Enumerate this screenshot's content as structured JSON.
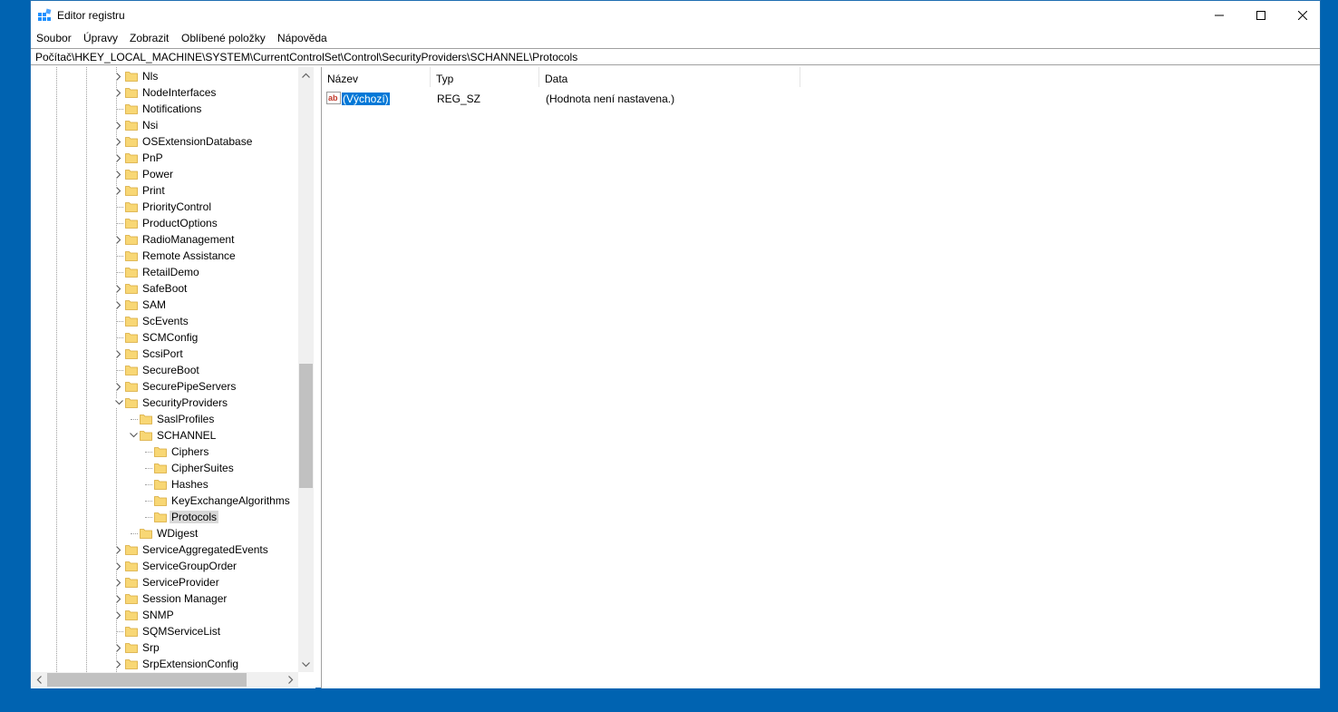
{
  "window": {
    "title": "Editor registru",
    "minimize_glyph": "—",
    "maximize_glyph": "☐",
    "close_glyph": "✕"
  },
  "menu": [
    "Soubor",
    "Úpravy",
    "Zobrazit",
    "Oblíbené položky",
    "Nápověda"
  ],
  "address": "Počítač\\HKEY_LOCAL_MACHINE\\SYSTEM\\CurrentControlSet\\Control\\SecurityProviders\\SCHANNEL\\Protocols",
  "tree": [
    {
      "label": "Nls",
      "expander": "collapsed"
    },
    {
      "label": "NodeInterfaces",
      "expander": "collapsed"
    },
    {
      "label": "Notifications",
      "expander": "none"
    },
    {
      "label": "Nsi",
      "expander": "collapsed"
    },
    {
      "label": "OSExtensionDatabase",
      "expander": "collapsed"
    },
    {
      "label": "PnP",
      "expander": "collapsed"
    },
    {
      "label": "Power",
      "expander": "collapsed"
    },
    {
      "label": "Print",
      "expander": "collapsed"
    },
    {
      "label": "PriorityControl",
      "expander": "none"
    },
    {
      "label": "ProductOptions",
      "expander": "none"
    },
    {
      "label": "RadioManagement",
      "expander": "collapsed"
    },
    {
      "label": "Remote Assistance",
      "expander": "none"
    },
    {
      "label": "RetailDemo",
      "expander": "none"
    },
    {
      "label": "SafeBoot",
      "expander": "collapsed"
    },
    {
      "label": "SAM",
      "expander": "collapsed"
    },
    {
      "label": "ScEvents",
      "expander": "none"
    },
    {
      "label": "SCMConfig",
      "expander": "none"
    },
    {
      "label": "ScsiPort",
      "expander": "collapsed"
    },
    {
      "label": "SecureBoot",
      "expander": "none"
    },
    {
      "label": "SecurePipeServers",
      "expander": "collapsed"
    },
    {
      "label": "SecurityProviders",
      "expander": "expanded"
    },
    {
      "label": "SaslProfiles",
      "expander": "none"
    },
    {
      "label": "SCHANNEL",
      "expander": "expanded"
    },
    {
      "label": "Ciphers",
      "expander": "none"
    },
    {
      "label": "CipherSuites",
      "expander": "none"
    },
    {
      "label": "Hashes",
      "expander": "none"
    },
    {
      "label": "KeyExchangeAlgorithms",
      "expander": "none"
    },
    {
      "label": "Protocols",
      "expander": "none",
      "selected": true
    },
    {
      "label": "WDigest",
      "expander": "none"
    },
    {
      "label": "ServiceAggregatedEvents",
      "expander": "collapsed"
    },
    {
      "label": "ServiceGroupOrder",
      "expander": "collapsed"
    },
    {
      "label": "ServiceProvider",
      "expander": "collapsed"
    },
    {
      "label": "Session Manager",
      "expander": "collapsed"
    },
    {
      "label": "SNMP",
      "expander": "collapsed"
    },
    {
      "label": "SQMServiceList",
      "expander": "none"
    },
    {
      "label": "Srp",
      "expander": "collapsed"
    },
    {
      "label": "SrpExtensionConfig",
      "expander": "collapsed"
    }
  ],
  "list": {
    "columns": [
      "Název",
      "Typ",
      "Data"
    ],
    "rows": [
      {
        "name": "(Výchozí)",
        "type": "REG_SZ",
        "data": "(Hodnota není nastavena.)",
        "icon": "string-value-icon"
      }
    ]
  },
  "colors": {
    "desktop": "#0063b1",
    "selection": "#0078d7",
    "folder": "#f8d775"
  }
}
